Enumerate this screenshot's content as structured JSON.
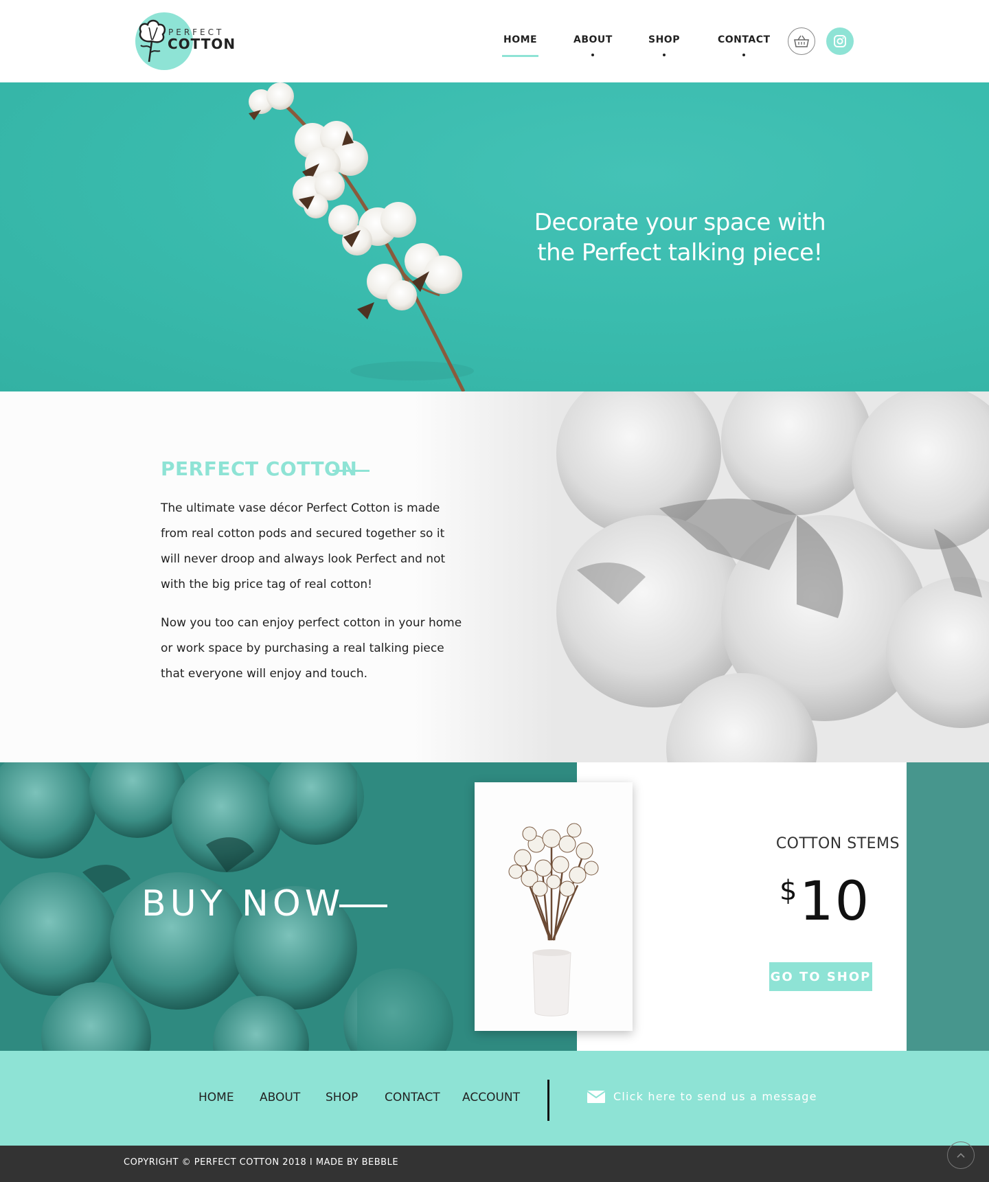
{
  "brand": {
    "small": "PERFECT",
    "big": "COTTON"
  },
  "nav": {
    "items": [
      {
        "label": "HOME",
        "active": true
      },
      {
        "label": "ABOUT",
        "active": false
      },
      {
        "label": "SHOP",
        "active": false
      },
      {
        "label": "CONTACT",
        "active": false
      }
    ],
    "cart_icon": "basket-icon",
    "social_icon": "instagram-icon"
  },
  "hero": {
    "line1": "Decorate your space with",
    "line2": "the Perfect talking piece!"
  },
  "about": {
    "title": "PERFECT COTTON",
    "p1": "The ultimate vase décor Perfect Cotton is made from real cotton pods and secured together so it will never droop and always look Perfect and not with the big price tag of real cotton!",
    "p2": "Now you too can enjoy perfect cotton in your home or work space by purchasing a real talking piece that everyone will enjoy and touch."
  },
  "product": {
    "buy_now": "BUY NOW",
    "name": "COTTON STEMS",
    "currency": "$",
    "price": "10",
    "cta": "GO TO SHOP"
  },
  "footer": {
    "links": [
      "HOME",
      "ABOUT",
      "SHOP",
      "CONTACT",
      "ACCOUNT"
    ],
    "message": "Click here to send us a message",
    "message_icon": "envelope-icon",
    "copyright": "COPYRIGHT © PERFECT COTTON 2018 I MADE BY BEBBLE",
    "scroll_top_icon": "chevron-up-icon"
  },
  "colors": {
    "accent": "#8ee3d5",
    "hero": "#3abcae",
    "product_dark": "#2f8a80",
    "footer_dark": "#333333"
  }
}
